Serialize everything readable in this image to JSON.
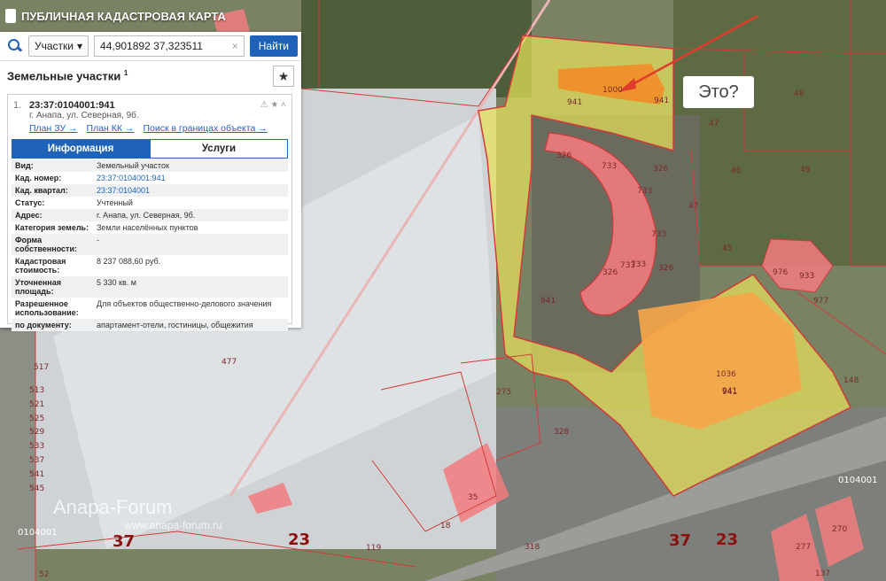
{
  "header": {
    "title": "ПУБЛИЧНАЯ КАДАСТРОВАЯ КАРТА"
  },
  "search": {
    "type": "Участки",
    "value": "44,901892 37,323511",
    "button": "Найти"
  },
  "results": {
    "heading": "Земельные участки",
    "count": "1"
  },
  "card": {
    "index": "1.",
    "cad_number": "23:37:0104001:941",
    "address": "г. Анапа, ул. Северная, 9б.",
    "links": [
      "План ЗУ →",
      "План КК →",
      "Поиск в границах объекта →"
    ],
    "tabs": [
      "Информация",
      "Услуги"
    ],
    "rows": [
      {
        "k": "Вид:",
        "v": "Земельный участок"
      },
      {
        "k": "Кад. номер:",
        "v": "23:37:0104001:941"
      },
      {
        "k": "Кад. квартал:",
        "v": "23:37:0104001"
      },
      {
        "k": "Статус:",
        "v": "Учтенный"
      },
      {
        "k": "Адрес:",
        "v": "г. Анапа, ул. Северная, 9б."
      },
      {
        "k": "Категория земель:",
        "v": "Земли населённых пунктов"
      },
      {
        "k": "Форма собственности:",
        "v": "-"
      },
      {
        "k": "Кадастровая стоимость:",
        "v": "8 237 088,60 руб."
      },
      {
        "k": "Уточненная площадь:",
        "v": "5 330 кв. м"
      },
      {
        "k": "Разрешенное использование:",
        "v": "Для объектов общественно-делового значения"
      },
      {
        "k": "по документу:",
        "v": "апартамент-отели, гостиницы, общежития"
      }
    ]
  },
  "annotation": {
    "text": "Это?"
  },
  "watermark": {
    "brand": "Anapa-Forum",
    "url": "www.anapa-forum.ru"
  },
  "map_labels": [
    "941",
    "941",
    "941",
    "1000",
    "326",
    "326",
    "326",
    "326",
    "733",
    "733",
    "733",
    "733",
    "733",
    "941",
    "1036",
    "941",
    "976",
    "933",
    "977",
    "148",
    "48",
    "47",
    "46",
    "49",
    "47",
    "45",
    "275",
    "328",
    "477",
    "35",
    "18",
    "318",
    "119",
    "517",
    "513",
    "521",
    "525",
    "529",
    "533",
    "537",
    "541",
    "545",
    "0104001",
    "0104001",
    "37",
    "23",
    "37",
    "23",
    "277",
    "270",
    "137",
    "52"
  ]
}
